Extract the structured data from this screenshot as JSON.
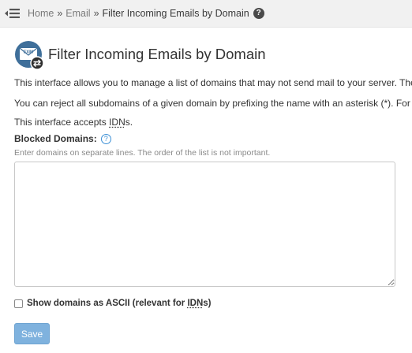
{
  "breadcrumb": {
    "home": "Home",
    "sep1": "»",
    "email": "Email",
    "sep2": "»",
    "current": "Filter Incoming Emails by Domain",
    "help_glyph": "?"
  },
  "page": {
    "title": "Filter Incoming Emails by Domain",
    "icon_text": "EXIM",
    "intro": "This interface allows you to manage a list of domains that may not send mail to your server. The s",
    "subdomains_note": "You can reject all subdomains of a given domain by prefixing the name with an asterisk (*). For ex",
    "idn_prefix": "This interface accepts ",
    "idn_abbr": "IDN",
    "idn_suffix": "s."
  },
  "form": {
    "blocked_label": "Blocked Domains:",
    "help_glyph": "?",
    "hint": "Enter domains on separate lines. The order of the list is not important.",
    "domains_value": "",
    "ascii_label_prefix": "Show domains as ASCII (relevant for ",
    "ascii_label_abbr": "IDN",
    "ascii_label_suffix": "s)",
    "ascii_checked": false,
    "save_label": "Save"
  },
  "icons": {
    "menu": "hamburger-icon",
    "help": "help-icon",
    "app": "exim-envelope-icon"
  },
  "colors": {
    "topbar_bg": "#f1f1f1",
    "save_button": "#7fb2de",
    "help_link": "#3b8fd6",
    "icon_bg": "#3f6f9a"
  }
}
